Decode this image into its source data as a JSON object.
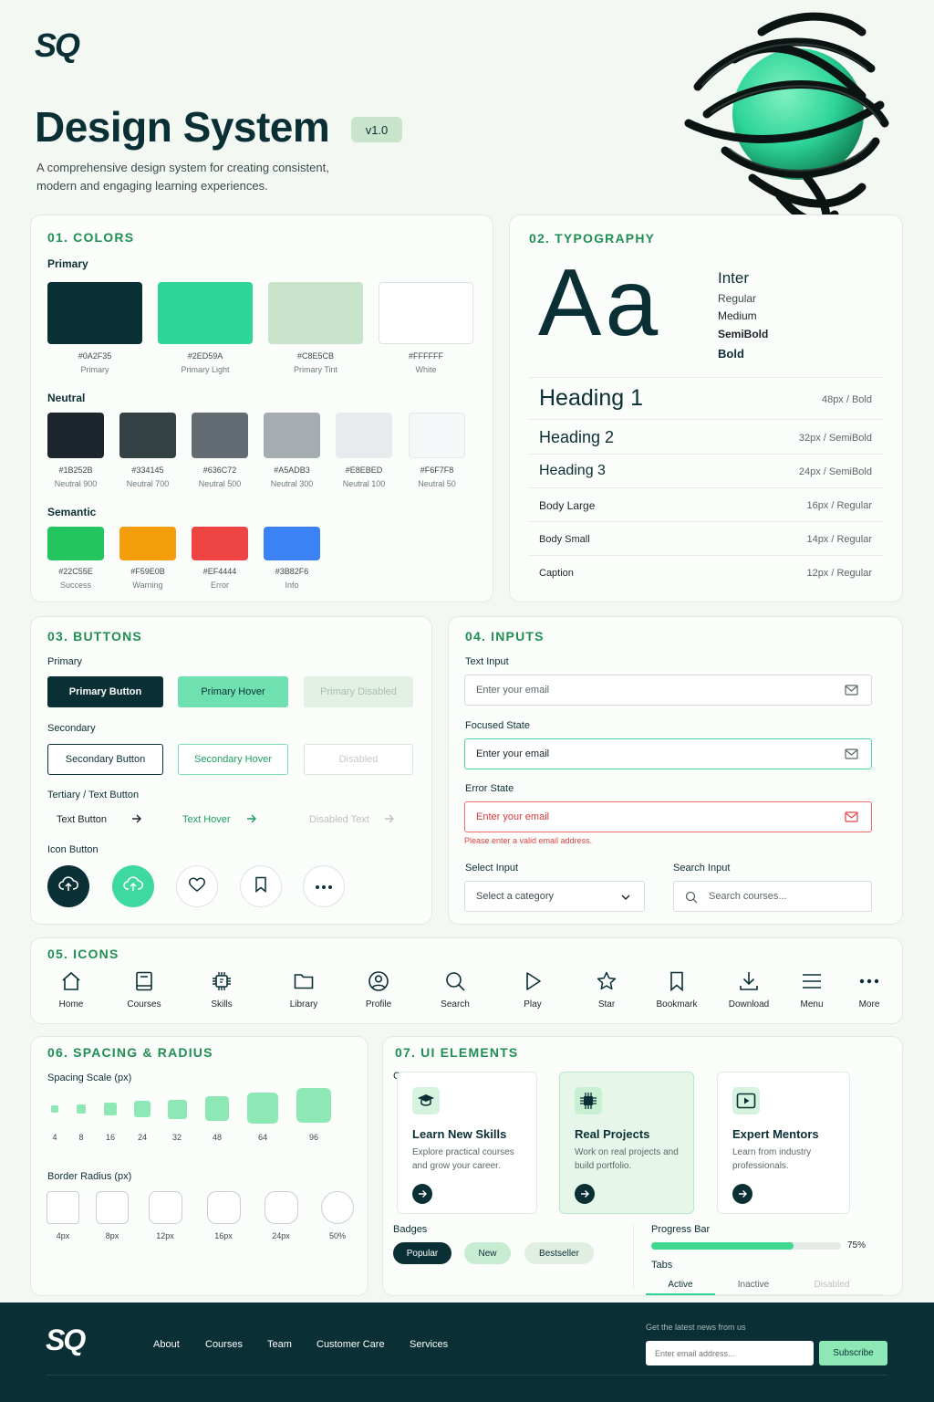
{
  "brand": {
    "logo": "SQ"
  },
  "hero": {
    "title": "Design System",
    "version": "v1.0",
    "description_line1": "A comprehensive design system for creating consistent,",
    "description_line2": "modern and engaging learning experiences."
  },
  "colors": {
    "title": "01. COLORS",
    "primary_label": "Primary",
    "primary": [
      {
        "hex": "#0A2F35",
        "name": "Primary"
      },
      {
        "hex": "#2ED59A",
        "name": "Primary Light"
      },
      {
        "hex": "#C8E5CB",
        "name": "Primary Tint"
      },
      {
        "hex": "#FFFFFF",
        "name": "White"
      }
    ],
    "neutral_label": "Neutral",
    "neutral": [
      {
        "hex": "#1B252B",
        "name": "Neutral 900"
      },
      {
        "hex": "#334145",
        "name": "Neutral 700"
      },
      {
        "hex": "#636C72",
        "name": "Neutral 500"
      },
      {
        "hex": "#A5ADB3",
        "name": "Neutral 300"
      },
      {
        "hex": "#E8EBED",
        "name": "Neutral 100"
      },
      {
        "hex": "#F6F7F8",
        "name": "Neutral 50"
      }
    ],
    "semantic_label": "Semantic",
    "semantic": [
      {
        "hex": "#22C55E",
        "name": "Success"
      },
      {
        "hex": "#F59E0B",
        "name": "Warning"
      },
      {
        "hex": "#EF4444",
        "name": "Error"
      },
      {
        "hex": "#3B82F6",
        "name": "Info"
      }
    ]
  },
  "typography": {
    "title": "02. TYPOGRAPHY",
    "specimen": "Aa",
    "font_name": "Inter",
    "weights": [
      "Regular",
      "Medium",
      "SemiBold",
      "Bold"
    ],
    "rows": [
      {
        "name": "Heading 1",
        "spec": "48px / Bold"
      },
      {
        "name": "Heading 2",
        "spec": "32px / SemiBold"
      },
      {
        "name": "Heading 3",
        "spec": "24px / SemiBold"
      },
      {
        "name": "Body Large",
        "spec": "16px / Regular"
      },
      {
        "name": "Body Small",
        "spec": "14px / Regular"
      },
      {
        "name": "Caption",
        "spec": "12px / Regular"
      }
    ]
  },
  "buttons": {
    "title": "03. BUTTONS",
    "primary_label": "Primary",
    "primary": [
      "Primary Button",
      "Primary Hover",
      "Primary Disabled"
    ],
    "secondary_label": "Secondary",
    "secondary": [
      "Secondary Button",
      "Secondary Hover",
      "Disabled"
    ],
    "tertiary_label": "Tertiary / Text Button",
    "tertiary": [
      "Text Button",
      "Text Hover",
      "Disabled Text"
    ],
    "icon_label": "Icon Button"
  },
  "inputs": {
    "title": "04. INPUTS",
    "text_label": "Text Input",
    "text_placeholder": "Enter your email",
    "focused_label": "Focused State",
    "focused_placeholder": "Enter your email",
    "error_label": "Error State",
    "error_placeholder": "Enter your email",
    "error_message": "Please enter a valid email address.",
    "select_label": "Select Input",
    "select_value": "Select a category",
    "search_label": "Search Input",
    "search_placeholder": "Search courses..."
  },
  "icons": {
    "title": "05. ICONS",
    "items": [
      {
        "label": "Home",
        "icon": "home-icon"
      },
      {
        "label": "Courses",
        "icon": "book-icon"
      },
      {
        "label": "Skills",
        "icon": "chip-icon"
      },
      {
        "label": "Library",
        "icon": "folder-icon"
      },
      {
        "label": "Profile",
        "icon": "user-icon"
      },
      {
        "label": "Search",
        "icon": "search-icon"
      },
      {
        "label": "Play",
        "icon": "play-icon"
      },
      {
        "label": "Star",
        "icon": "star-icon"
      },
      {
        "label": "Bookmark",
        "icon": "bookmark-icon"
      },
      {
        "label": "Download",
        "icon": "download-icon"
      },
      {
        "label": "Menu",
        "icon": "menu-icon"
      },
      {
        "label": "More",
        "icon": "more-icon"
      }
    ]
  },
  "spacing": {
    "title": "06. SPACING & RADIUS",
    "scale_label": "Spacing Scale (px)",
    "scale": [
      "4",
      "8",
      "16",
      "24",
      "32",
      "48",
      "64",
      "96"
    ],
    "radius_label": "Border Radius (px)",
    "radius": [
      "4px",
      "8px",
      "12px",
      "16px",
      "24px",
      "50%"
    ]
  },
  "ui": {
    "title": "07. UI ELEMENTS",
    "cards_label": "Cards",
    "cards": [
      {
        "title": "Learn New Skills",
        "desc": "Explore practical courses and grow your career."
      },
      {
        "title": "Real Projects",
        "desc": "Work on real projects and build portfolio."
      },
      {
        "title": "Expert Mentors",
        "desc": "Learn from industry professionals."
      }
    ],
    "badges_label": "Badges",
    "badges": [
      "Popular",
      "New",
      "Bestseller"
    ],
    "progress_label": "Progress Bar",
    "progress_value": 0.75,
    "progress_text": "75%",
    "tabs_label": "Tabs",
    "tabs": [
      "Active",
      "Inactive",
      "Disabled"
    ]
  },
  "footer": {
    "logo": "SQ",
    "nav": [
      "About",
      "Courses",
      "Team",
      "Customer Care",
      "Services"
    ],
    "newsletter_label": "Get the latest news from us",
    "email_placeholder": "Enter email address...",
    "subscribe_label": "Subscribe"
  }
}
